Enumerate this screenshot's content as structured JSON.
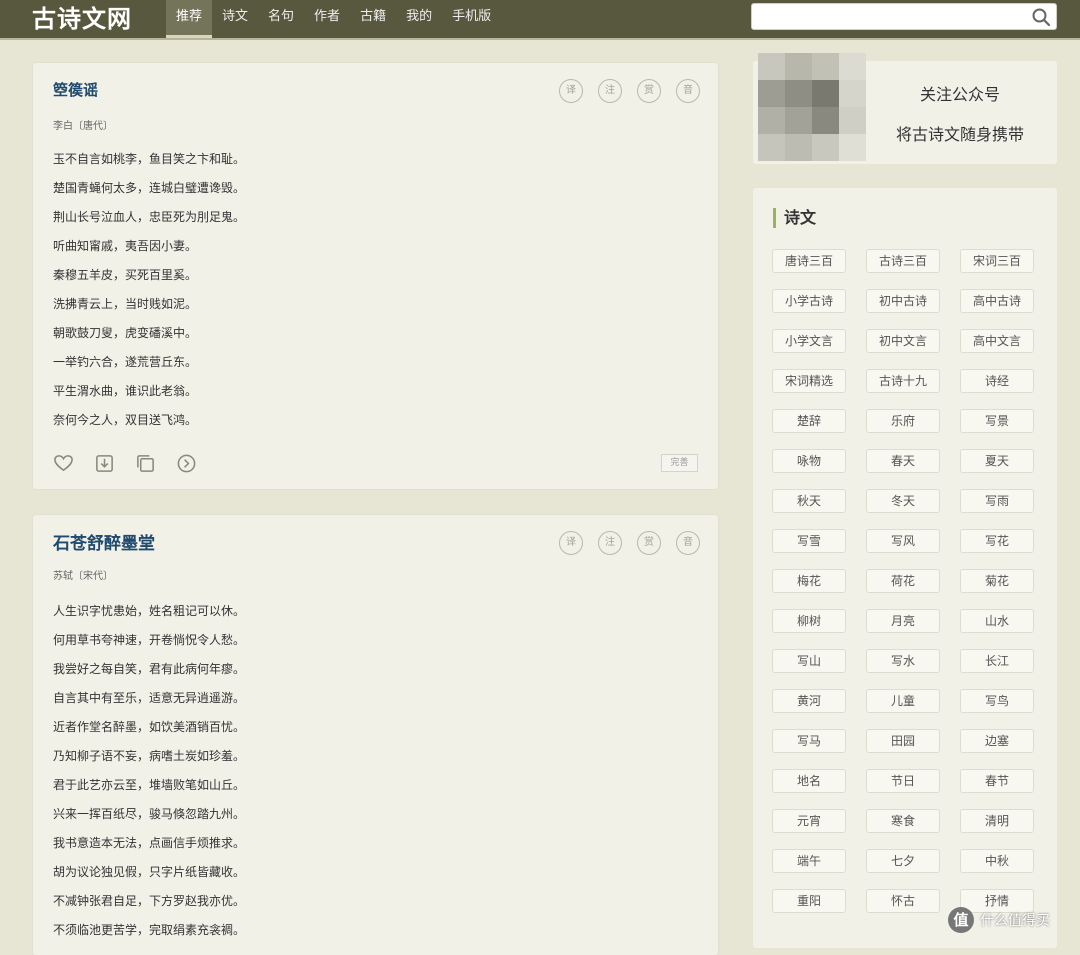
{
  "site": {
    "logo": "古诗文网"
  },
  "nav": {
    "items": [
      {
        "label": "推荐",
        "active": true
      },
      {
        "label": "诗文",
        "active": false
      },
      {
        "label": "名句",
        "active": false
      },
      {
        "label": "作者",
        "active": false
      },
      {
        "label": "古籍",
        "active": false
      },
      {
        "label": "我的",
        "active": false
      },
      {
        "label": "手机版",
        "active": false
      }
    ]
  },
  "search": {
    "placeholder": "",
    "icon": "search-icon"
  },
  "poems": [
    {
      "title": "箜篌谣",
      "author": "李白〔唐代〕",
      "lines": [
        "玉不自言如桃李，鱼目笑之卞和耻。",
        "楚国青蝇何太多，连城白璧遭谗毁。",
        "荆山长号泣血人，忠臣死为刖足鬼。",
        "听曲知甯戚，夷吾因小妻。",
        "秦穆五羊皮，买死百里奚。",
        "洗拂青云上，当时贱如泥。",
        "朝歌鼓刀叟，虎变磻溪中。",
        "一举钓六合，遂荒营丘东。",
        "平生渭水曲，谁识此老翁。",
        "奈何今之人，双目送飞鸿。"
      ],
      "tools": [
        "译",
        "注",
        "赏",
        "音"
      ],
      "complete_label": "完善"
    },
    {
      "title": "石苍舒醉墨堂",
      "author": "苏轼〔宋代〕",
      "lines": [
        "人生识字忧患始，姓名粗记可以休。",
        "何用草书夸神速，开卷惝怳令人愁。",
        "我尝好之每自笑，君有此病何年瘳。",
        "自言其中有至乐，适意无异逍遥游。",
        "近者作堂名醉墨，如饮美酒销百忧。",
        "乃知柳子语不妄，病嗜土炭如珍羞。",
        "君于此艺亦云至，堆墙败笔如山丘。",
        "兴来一挥百纸尽，骏马倏忽踏九州。",
        "我书意造本无法，点画信手烦推求。",
        "胡为议论独见假，只字片纸皆藏收。",
        "不减钟张君自足，下方罗赵我亦优。",
        "不须临池更苦学，完取绢素充衾裯。"
      ],
      "tools": [
        "译",
        "注",
        "赏",
        "音"
      ]
    }
  ],
  "sidebar": {
    "qr_line1": "关注公众号",
    "qr_line2": "将古诗文随身携带",
    "tags_heading": "诗文",
    "tags": [
      "唐诗三百",
      "古诗三百",
      "宋词三百",
      "小学古诗",
      "初中古诗",
      "高中古诗",
      "小学文言",
      "初中文言",
      "高中文言",
      "宋词精选",
      "古诗十九",
      "诗经",
      "楚辞",
      "乐府",
      "写景",
      "咏物",
      "春天",
      "夏天",
      "秋天",
      "冬天",
      "写雨",
      "写雪",
      "写风",
      "写花",
      "梅花",
      "荷花",
      "菊花",
      "柳树",
      "月亮",
      "山水",
      "写山",
      "写水",
      "长江",
      "黄河",
      "儿童",
      "写鸟",
      "写马",
      "田园",
      "边塞",
      "地名",
      "节日",
      "春节",
      "元宵",
      "寒食",
      "清明",
      "端午",
      "七夕",
      "中秋",
      "重阳",
      "怀古",
      "抒情"
    ]
  },
  "watermark": {
    "badge": "值",
    "text": "什么值得买"
  },
  "colors": {
    "topbar": "#58583e",
    "title_link": "#1f4a6e",
    "accent_bar": "#9ab35a"
  }
}
